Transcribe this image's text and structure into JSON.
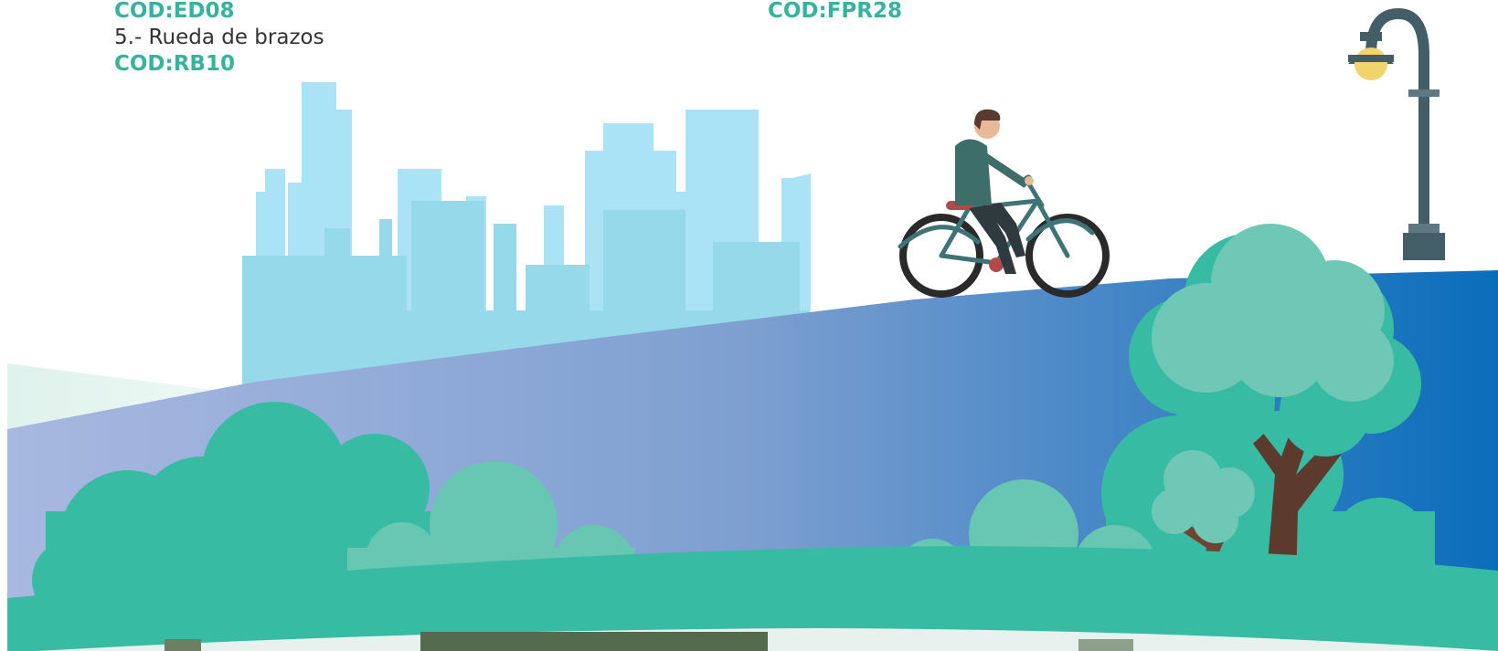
{
  "left_list": {
    "code_top": "COD:ED08",
    "item_5": "5.- Rueda de brazos",
    "code_item_5": "COD:RB10"
  },
  "middle_list": {
    "code_top": "COD:FPR28"
  },
  "colors": {
    "accent_green": "#36b39c",
    "hill_green": "#37bca3",
    "hill_light": "#67c7b3",
    "skyline_blue": "#a9e4f7",
    "skyline_blue_dark": "#94d8ea",
    "band_start": "#a8b8e0",
    "band_end": "#0a6dbb",
    "lamp_post": "#445e68",
    "lamp_light": "#f0d56c",
    "bike_frame": "#3e7477",
    "shirt": "#3d6e6a"
  },
  "icons": {
    "cyclist": "cyclist-illustration",
    "lamp": "street-lamp-icon",
    "skyline": "city-skyline-illustration",
    "tree": "tree-illustration",
    "bush": "bush-illustration"
  }
}
